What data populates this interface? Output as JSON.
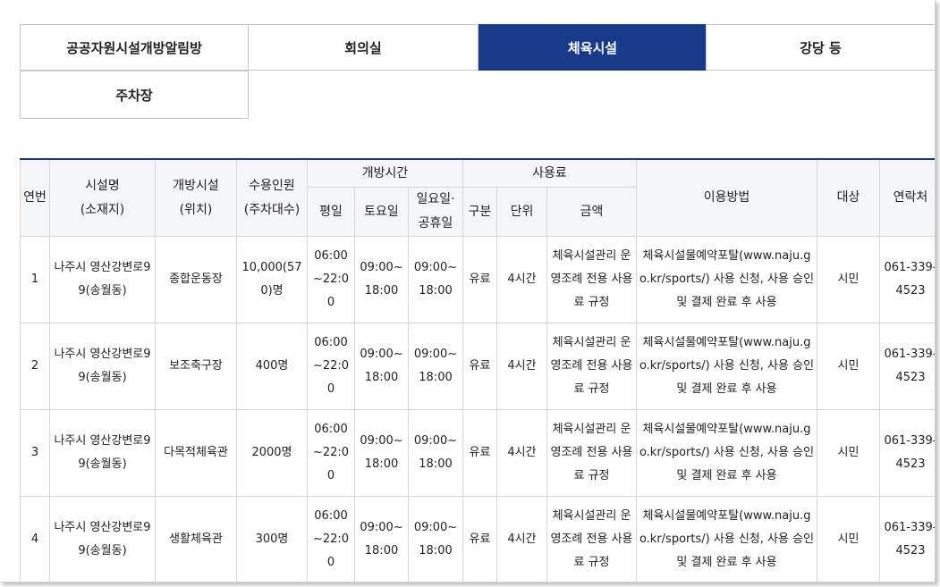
{
  "tabs": [
    {
      "label": "공공자원시설개방알림방",
      "active": false
    },
    {
      "label": "회의실",
      "active": false
    },
    {
      "label": "체육시설",
      "active": true
    },
    {
      "label": "강당 등",
      "active": false
    },
    {
      "label": "주차장",
      "active": false
    }
  ],
  "colors": {
    "accent": "#173a8b",
    "header_bg": "#f4f6f9",
    "border": "#d6d6d6"
  },
  "table": {
    "headers": {
      "no": "연번",
      "facility_name": "시설명\n(소재지)",
      "open_facility": "개방시설\n(위치)",
      "capacity": "수용인원\n(주차대수)",
      "open_hours": "개방시간",
      "weekday": "평일",
      "saturday": "토요일",
      "sunday_holiday": "일요일·\n공휴일",
      "fee": "사용료",
      "fee_type": "구분",
      "fee_unit": "단위",
      "fee_amount": "금액",
      "usage_method": "이용방법",
      "target": "대상",
      "contact": "연락처"
    },
    "rows": [
      {
        "no": "1",
        "facility_name": "나주시 영산강변로99(송월동)",
        "open_facility": "종합운동장",
        "capacity": "10,000(570)명",
        "weekday": "06:00~22:00",
        "saturday": "09:00~18:00",
        "sunday_holiday": "09:00~18:00",
        "fee_type": "유료",
        "fee_unit": "4시간",
        "fee_amount": "체육시설관리 운영조례 전용 사용료 규정",
        "usage_method": "체육시설물예약포탈(www.naju.go.kr/sports/) 사용 신청, 사용 승인 및 결제 완료 후 사용",
        "target": "시민",
        "contact": "061-339-4523"
      },
      {
        "no": "2",
        "facility_name": "나주시 영산강변로99(송월동)",
        "open_facility": "보조축구장",
        "capacity": "400명",
        "weekday": "06:00~22:00",
        "saturday": "09:00~18:00",
        "sunday_holiday": "09:00~18:00",
        "fee_type": "유료",
        "fee_unit": "4시간",
        "fee_amount": "체육시설관리 운영조례 전용 사용료 규정",
        "usage_method": "체육시설물예약포탈(www.naju.go.kr/sports/) 사용 신청, 사용 승인 및 결제 완료 후 사용",
        "target": "시민",
        "contact": "061-339-4523"
      },
      {
        "no": "3",
        "facility_name": "나주시 영산강변로99(송월동)",
        "open_facility": "다목적체육관",
        "capacity": "2000명",
        "weekday": "06:00~22:00",
        "saturday": "09:00~18:00",
        "sunday_holiday": "09:00~18:00",
        "fee_type": "유료",
        "fee_unit": "4시간",
        "fee_amount": "체육시설관리 운영조례 전용 사용료 규정",
        "usage_method": "체육시설물예약포탈(www.naju.go.kr/sports/) 사용 신청, 사용 승인 및 결제 완료 후 사용",
        "target": "시민",
        "contact": "061-339-4523"
      },
      {
        "no": "4",
        "facility_name": "나주시 영산강변로99(송월동)",
        "open_facility": "생활체육관",
        "capacity": "300명",
        "weekday": "06:00~22:00",
        "saturday": "09:00~18:00",
        "sunday_holiday": "09:00~18:00",
        "fee_type": "유료",
        "fee_unit": "4시간",
        "fee_amount": "체육시설관리 운영조례 전용 사용료 규정",
        "usage_method": "체육시설물예약포탈(www.naju.go.kr/sports/) 사용 신청, 사용 승인 및 결제 완료 후 사용",
        "target": "시민",
        "contact": "061-339-4523"
      }
    ]
  }
}
